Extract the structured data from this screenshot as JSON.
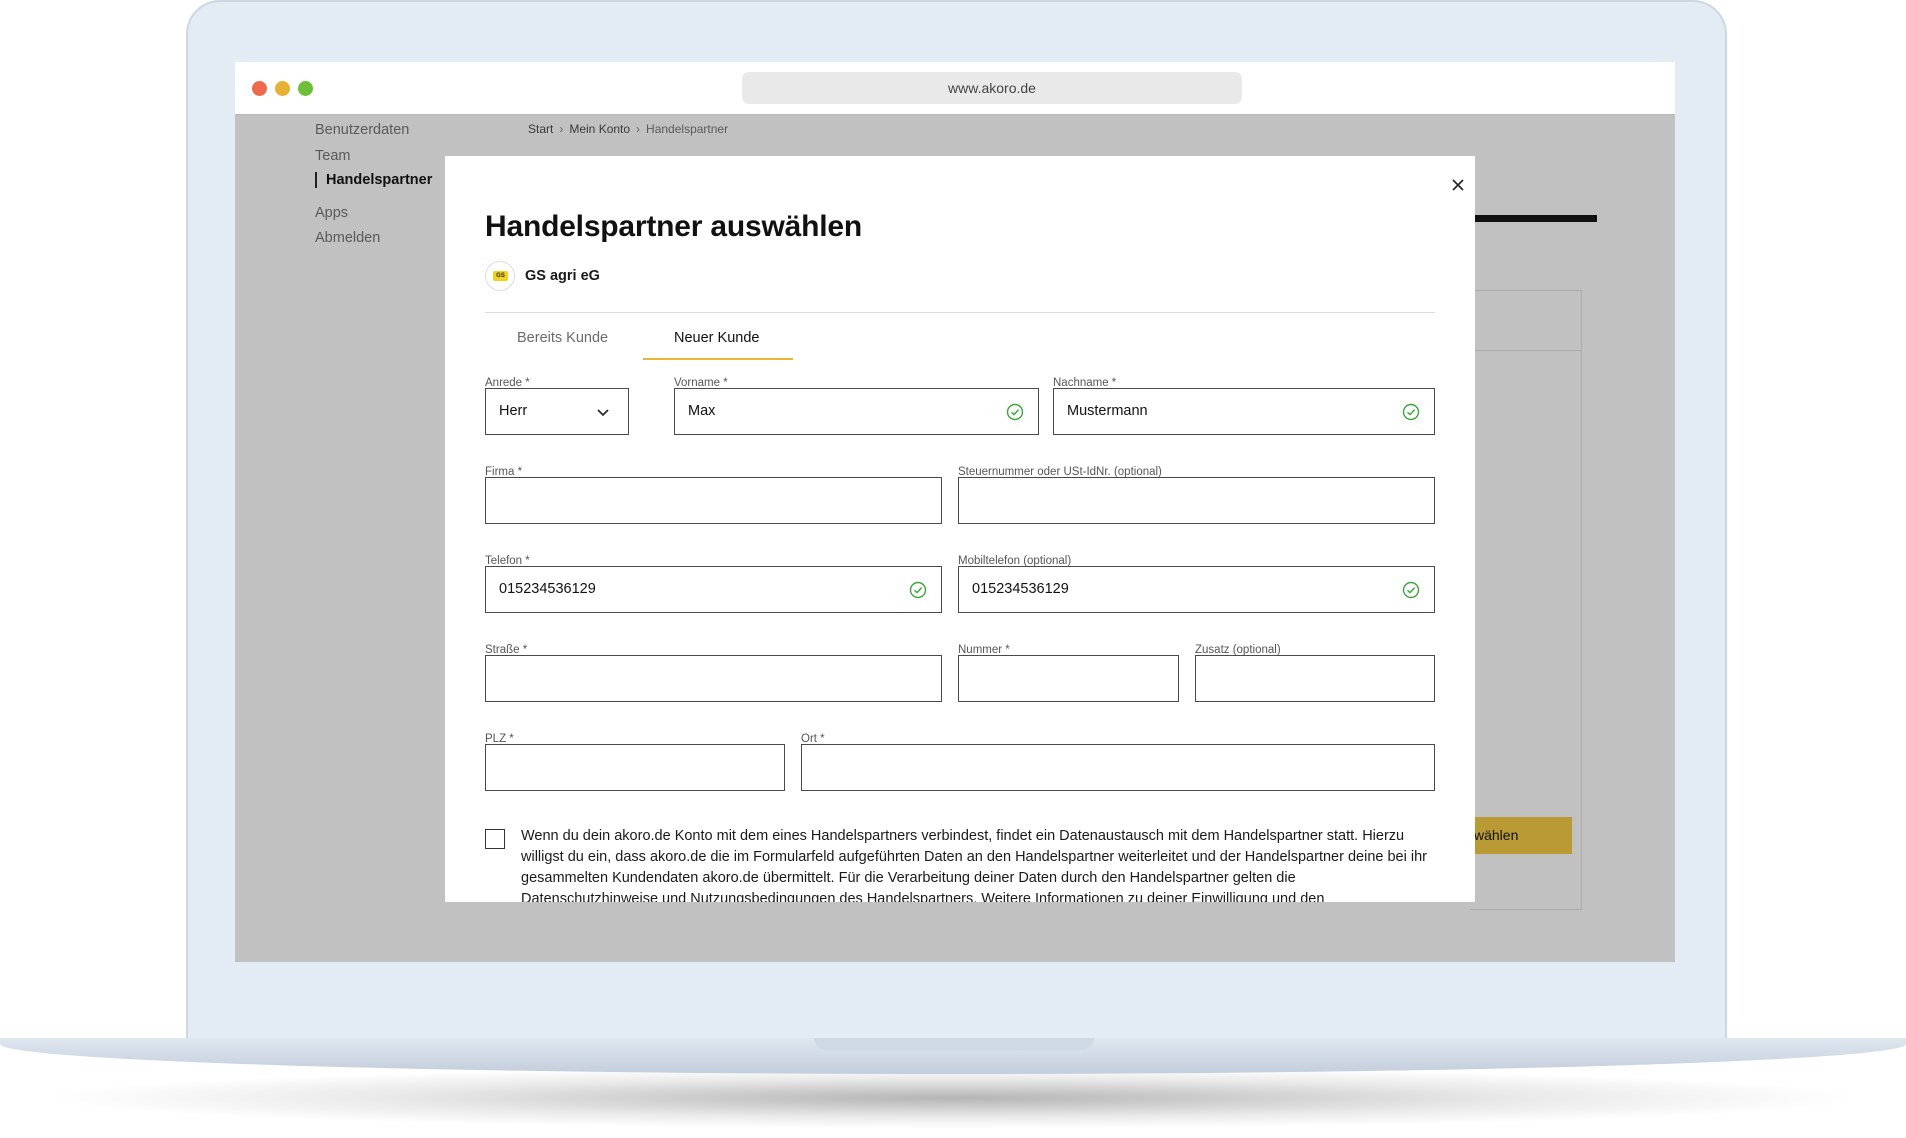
{
  "browser": {
    "url": "www.akoro.de"
  },
  "sidenav": {
    "items": [
      {
        "label": "Benutzerdaten"
      },
      {
        "label": "Team"
      },
      {
        "label": "Handelspartner"
      },
      {
        "label": "Apps"
      },
      {
        "label": "Abmelden"
      }
    ],
    "active": "Handelspartner"
  },
  "breadcrumb": {
    "items": [
      "Start",
      "Mein Konto",
      "Handelspartner"
    ],
    "separator": "›"
  },
  "background": {
    "button_label_fragment": "wählen"
  },
  "modal": {
    "title": "Handelspartner auswählen",
    "partner": {
      "name": "GS agri eG",
      "logo_text": "GS"
    },
    "tabs": [
      {
        "label": "Bereits Kunde",
        "active": false
      },
      {
        "label": "Neuer Kunde",
        "active": true
      }
    ],
    "form": {
      "anrede": {
        "label": "Anrede *",
        "value": "Herr"
      },
      "vorname": {
        "label": "Vorname *",
        "value": "Max"
      },
      "nachname": {
        "label": "Nachname *",
        "value": "Mustermann"
      },
      "firma": {
        "label": "Firma *",
        "value": ""
      },
      "steuernummer": {
        "label": "Steuernummer oder USt-IdNr. (optional)",
        "value": ""
      },
      "telefon": {
        "label": "Telefon *",
        "value": "015234536129"
      },
      "mobiltelefon": {
        "label": "Mobiltelefon (optional)",
        "value": "015234536129"
      },
      "strasse": {
        "label": "Straße *",
        "value": ""
      },
      "nummer": {
        "label": "Nummer *",
        "value": ""
      },
      "zusatz": {
        "label": "Zusatz (optional)",
        "value": ""
      },
      "plz": {
        "label": "PLZ *",
        "value": ""
      },
      "ort": {
        "label": "Ort *",
        "value": ""
      }
    },
    "consent_text": "Wenn du dein akoro.de Konto mit dem eines Handelspartners verbindest, findet ein Datenaustausch mit dem Handelspartner statt. Hierzu willigst du ein, dass akoro.de die im Formularfeld aufgeführten Daten an den Handelspartner weiterleitet und der Handelspartner deine bei ihr gesammelten Kundendaten akoro.de übermittelt. Für die Verarbeitung deiner Daten durch den Handelspartner gelten die Datenschutzhinweise und Nutzungsbedingungen des Handelspartners. Weitere Informationen zu deiner Einwilligung und den"
  },
  "colors": {
    "accent": "#e8b634",
    "valid_check": "#3aa53a",
    "overlay": "#c1c1c1"
  }
}
